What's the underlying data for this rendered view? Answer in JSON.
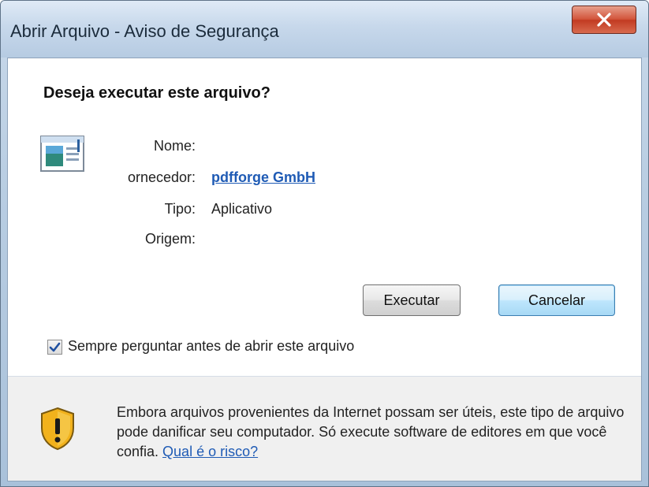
{
  "window": {
    "title": "Abrir Arquivo - Aviso de Segurança",
    "close_glyph": "X"
  },
  "question": "Deseja executar este arquivo?",
  "fields": {
    "name_label": "Nome:",
    "name_value": "",
    "publisher_label": "ornecedor:",
    "publisher_value": "pdfforge GmbH",
    "type_label": "Tipo:",
    "type_value": "Aplicativo",
    "origin_label": "Origem:",
    "origin_value": ""
  },
  "buttons": {
    "run": "Executar",
    "cancel": "Cancelar"
  },
  "checkbox": {
    "label": "Sempre perguntar antes de abrir este arquivo",
    "checked": true
  },
  "warning": {
    "text": "Embora arquivos provenientes da Internet possam ser úteis, este tipo de arquivo pode danificar seu computador. Só execute software de editores em que você confia. ",
    "link": "Qual é o risco?"
  },
  "icons": {
    "file": "application-file-icon",
    "shield": "security-shield-warning-icon",
    "check": "checkmark-icon"
  }
}
